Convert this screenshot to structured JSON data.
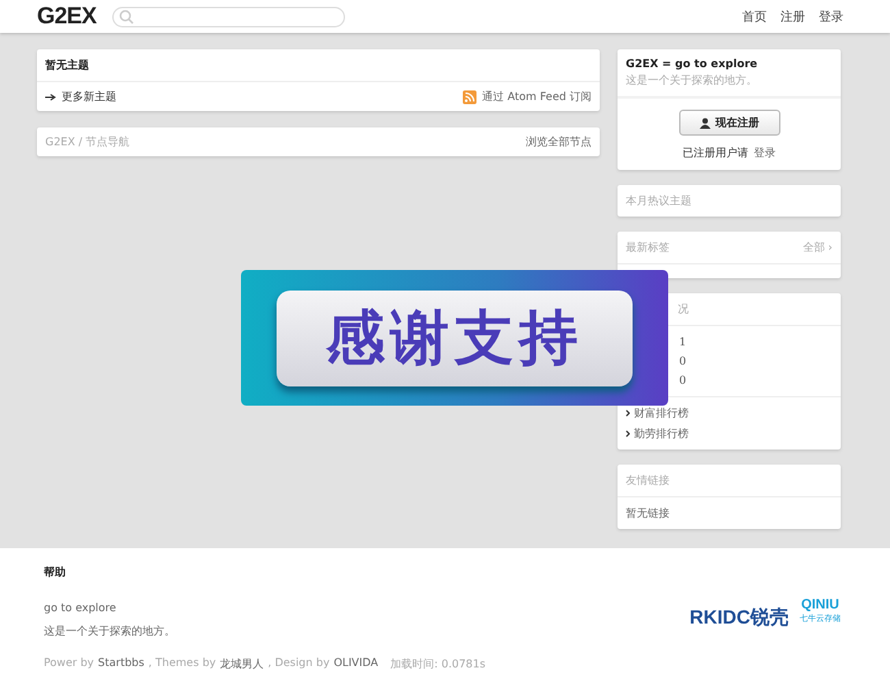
{
  "header": {
    "logo": "G2EX",
    "nav": [
      "首页",
      "注册",
      "登录"
    ]
  },
  "topics": {
    "title": "暂无主题",
    "more": "更多新主题",
    "feed": "通过 Atom Feed 订阅"
  },
  "nodes": {
    "path": "G2EX / 节点导航",
    "all": "浏览全部节点"
  },
  "intro": {
    "title": "G2EX = go to explore",
    "subtitle": "这是一个关于探索的地方。",
    "register": "现在注册",
    "registered": "已注册用户请",
    "login": "登录"
  },
  "hot": {
    "title": "本月热议主题"
  },
  "tags": {
    "title": "最新标签",
    "all": "全部 ›"
  },
  "stats": {
    "title": "况",
    "values": [
      "1",
      "0",
      "0"
    ],
    "links": [
      "财富排行榜",
      "勤劳排行榜"
    ]
  },
  "friends": {
    "title": "友情链接",
    "empty": "暂无链接"
  },
  "banner": {
    "text": "感谢支持"
  },
  "footer": {
    "title": "帮助",
    "tagline": "go to explore",
    "desc": "这是一个关于探索的地方。",
    "credits": [
      {
        "kind": "text",
        "text": "Power by"
      },
      {
        "kind": "link",
        "text": "Startbbs"
      },
      {
        "kind": "text",
        "text": ", Themes by"
      },
      {
        "kind": "link",
        "text": "龙城男人"
      },
      {
        "kind": "text",
        "text": ", Design by"
      },
      {
        "kind": "link",
        "text": "OLIVIDA"
      },
      {
        "kind": "text",
        "text": "加载时间: 0.0781s"
      }
    ],
    "sponsors": [
      {
        "name": "RKIDC锐壳"
      },
      {
        "name": "QINIU",
        "sub": "七牛云存储"
      }
    ]
  }
}
